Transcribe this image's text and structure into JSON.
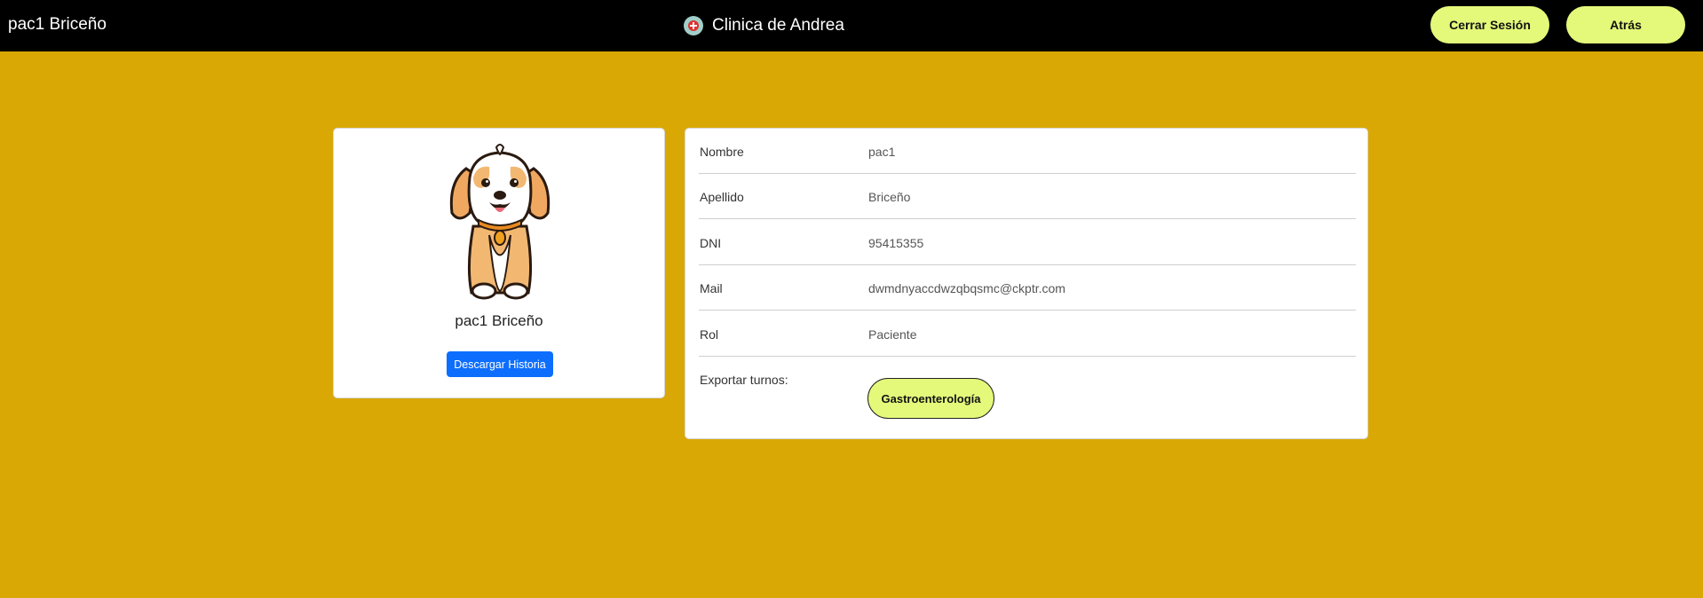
{
  "header": {
    "user_name": "pac1 Briceño",
    "brand_name": "Clinica de Andrea",
    "logout_label": "Cerrar Sesión",
    "back_label": "Atrás"
  },
  "profile": {
    "name": "pac1 Briceño",
    "download_label": "Descargar Historia",
    "avatar_icon": "dog-avatar-icon"
  },
  "info": {
    "rows": [
      {
        "label": "Nombre",
        "value": "pac1"
      },
      {
        "label": "Apellido",
        "value": "Briceño"
      },
      {
        "label": "DNI",
        "value": "95415355"
      },
      {
        "label": "Mail",
        "value": "dwmdnyaccdwzqbqsmc@ckptr.com"
      },
      {
        "label": "Rol",
        "value": "Paciente"
      }
    ],
    "export_label": "Exportar turnos:",
    "export_buttons": [
      "Gastroenterología"
    ]
  },
  "colors": {
    "background": "#d9a805",
    "topbar": "#000000",
    "accent_button": "#e4f97a",
    "primary_button": "#0d6efd"
  }
}
